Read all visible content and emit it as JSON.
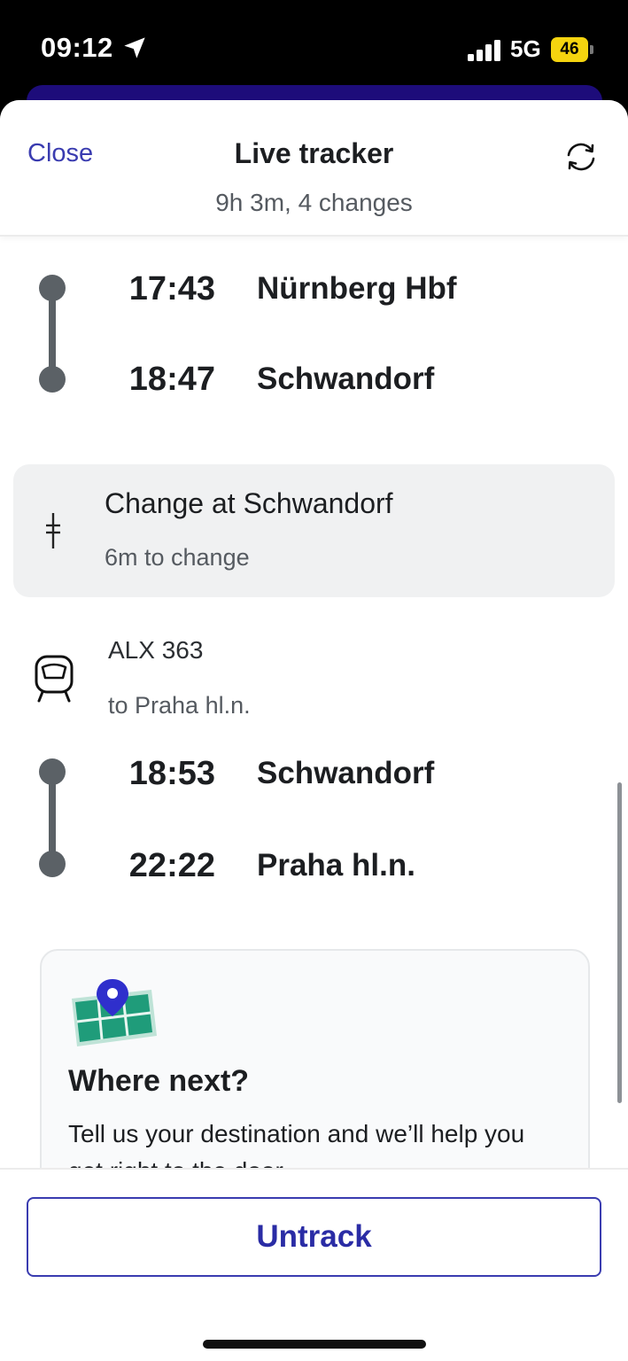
{
  "status_bar": {
    "time": "09:12",
    "network": "5G",
    "battery": "46"
  },
  "header": {
    "close_label": "Close",
    "title": "Live tracker",
    "subtitle": "9h 3m, 4 changes"
  },
  "legs": [
    {
      "stops": [
        {
          "time": "17:43",
          "station": "Nürnberg Hbf"
        },
        {
          "time": "18:47",
          "station": "Schwandorf"
        }
      ]
    },
    {
      "stops": [
        {
          "time": "18:53",
          "station": "Schwandorf"
        },
        {
          "time": "22:22",
          "station": "Praha hl.n."
        }
      ]
    }
  ],
  "change": {
    "title": "Change at Schwandorf",
    "subtitle": "6m to change"
  },
  "train": {
    "name": "ALX 363",
    "destination": "to Praha hl.n."
  },
  "where_next": {
    "title": "Where next?",
    "text": "Tell us your destination and we’ll help you get right to the door"
  },
  "footer": {
    "untrack_label": "Untrack"
  },
  "colors": {
    "accent": "#3a3cb0",
    "map_green": "#1f9c7a",
    "pin": "#2f2fcc",
    "track": "#5b6166",
    "battery": "#f5d40f"
  }
}
